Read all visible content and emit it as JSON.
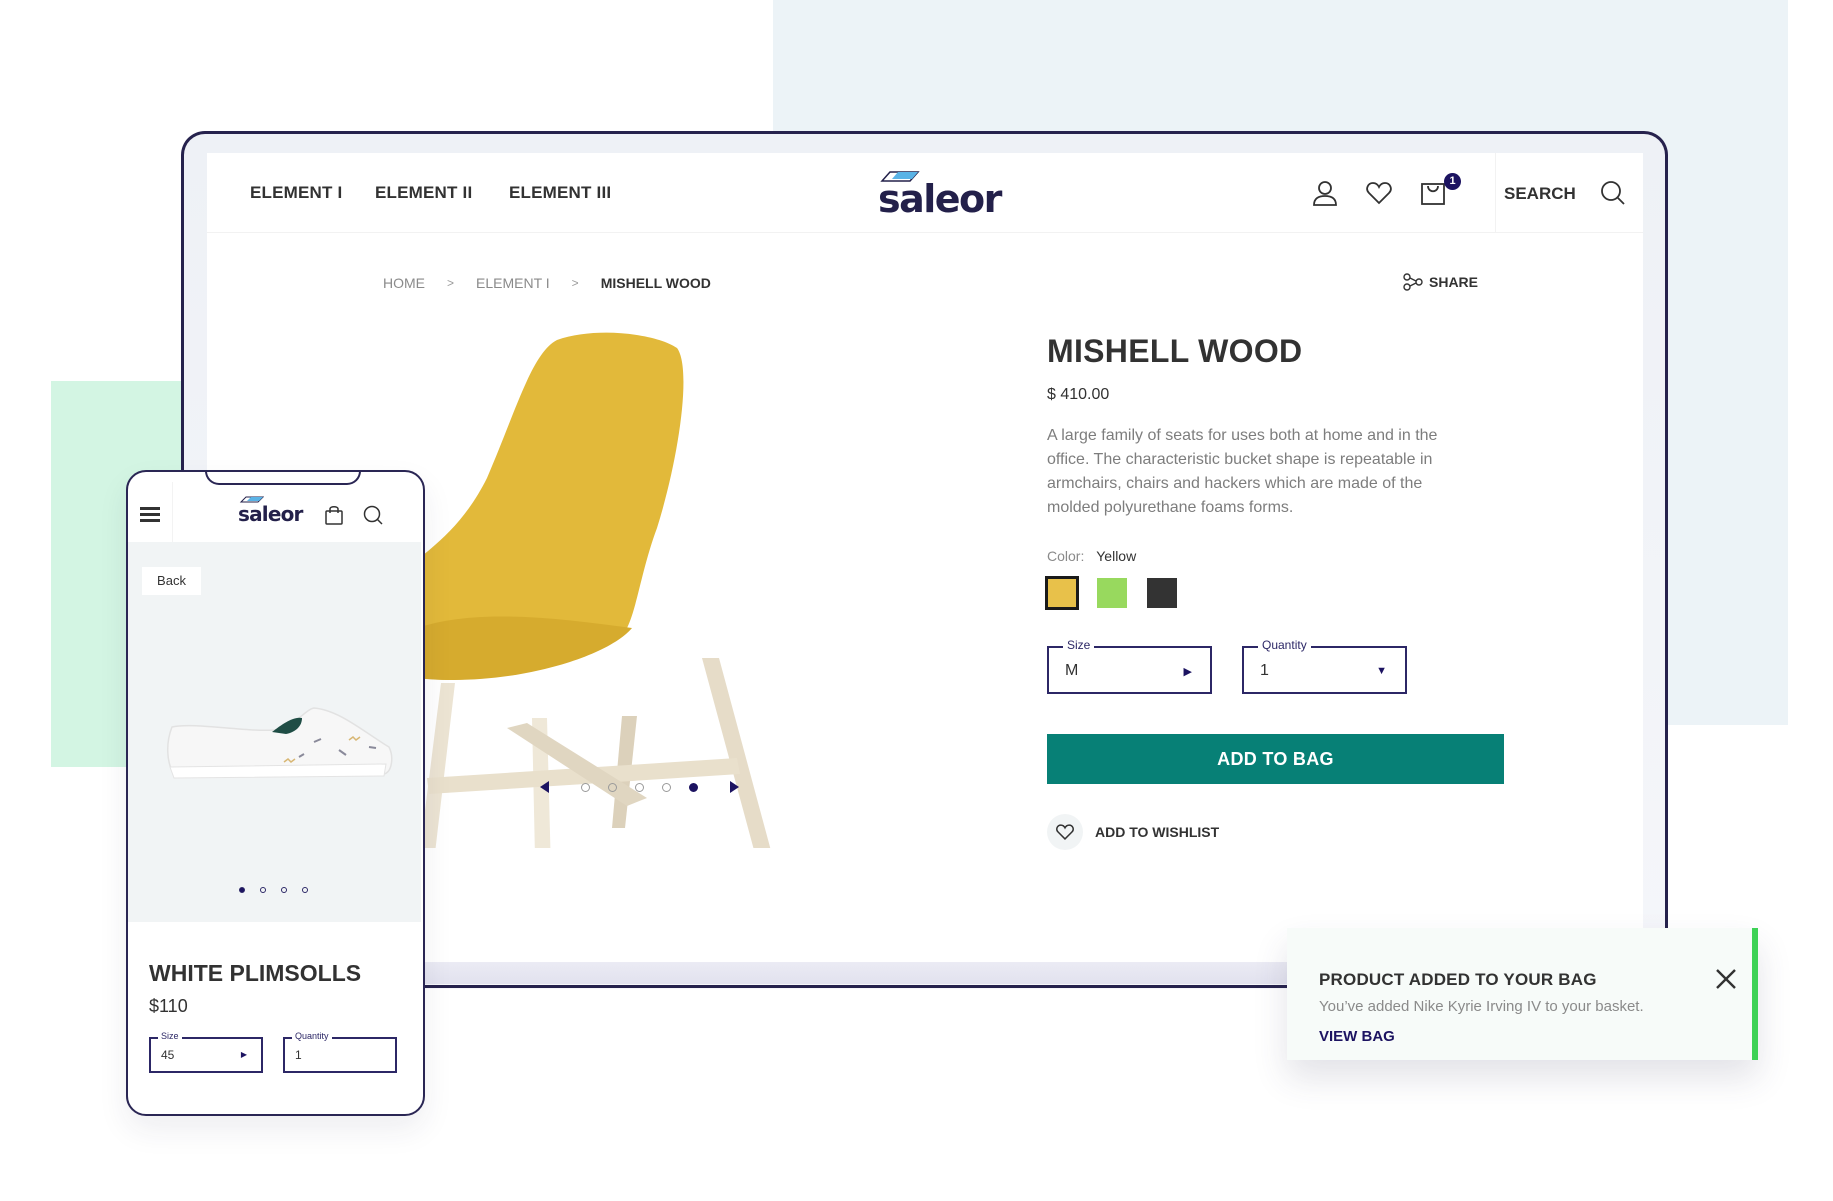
{
  "colors": {
    "brand_navy": "#1c1361",
    "accent_teal": "#078076",
    "success_green": "#3ed256",
    "bg_blue": "#ecf3f7",
    "bg_green": "#d3f5e3"
  },
  "desktop": {
    "header": {
      "nav": [
        {
          "label": "ELEMENT I"
        },
        {
          "label": "ELEMENT II"
        },
        {
          "label": "ELEMENT III"
        }
      ],
      "logo": "saleor",
      "icons": [
        "user-icon",
        "heart-icon",
        "shopping-bag-icon",
        "search-icon"
      ],
      "cart_count": "1",
      "search_label": "SEARCH"
    },
    "breadcrumb": [
      {
        "label": "HOME"
      },
      {
        "label": "ELEMENT I"
      },
      {
        "label": "MISHELL WOOD"
      }
    ],
    "breadcrumb_separator": ">",
    "share_label": "SHARE",
    "gallery": {
      "total_slides": 5,
      "active_slide": 5
    },
    "product": {
      "title": "MISHELL WOOD",
      "price": "$ 410.00",
      "description": "A large family of seats for uses both at home and in the office. The characteristic bucket shape is repeatable in armchairs, chairs and hackers which are made of the molded polyurethane foams forms.",
      "color_label": "Color:",
      "color_value": "Yellow",
      "swatches": [
        {
          "name": "Yellow",
          "hex": "#e8c14a",
          "selected": true
        },
        {
          "name": "Green",
          "hex": "#98d95e",
          "selected": false
        },
        {
          "name": "Black",
          "hex": "#333333",
          "selected": false
        }
      ],
      "size": {
        "label": "Size",
        "value": "M"
      },
      "quantity": {
        "label": "Quantity",
        "value": "1"
      },
      "add_to_bag": "ADD TO BAG",
      "add_to_wishlist": "ADD TO WISHLIST"
    }
  },
  "mobile": {
    "logo": "saleor",
    "back_label": "Back",
    "gallery": {
      "total_slides": 4,
      "active_slide": 1
    },
    "product": {
      "title": "WHITE PLIMSOLLS",
      "price": "$110",
      "size": {
        "label": "Size",
        "value": "45"
      },
      "quantity": {
        "label": "Quantity",
        "value": "1"
      }
    }
  },
  "toast": {
    "title": "PRODUCT ADDED TO YOUR BAG",
    "message": "You’ve added Nike Kyrie Irving IV to your basket.",
    "link": "VIEW BAG"
  }
}
